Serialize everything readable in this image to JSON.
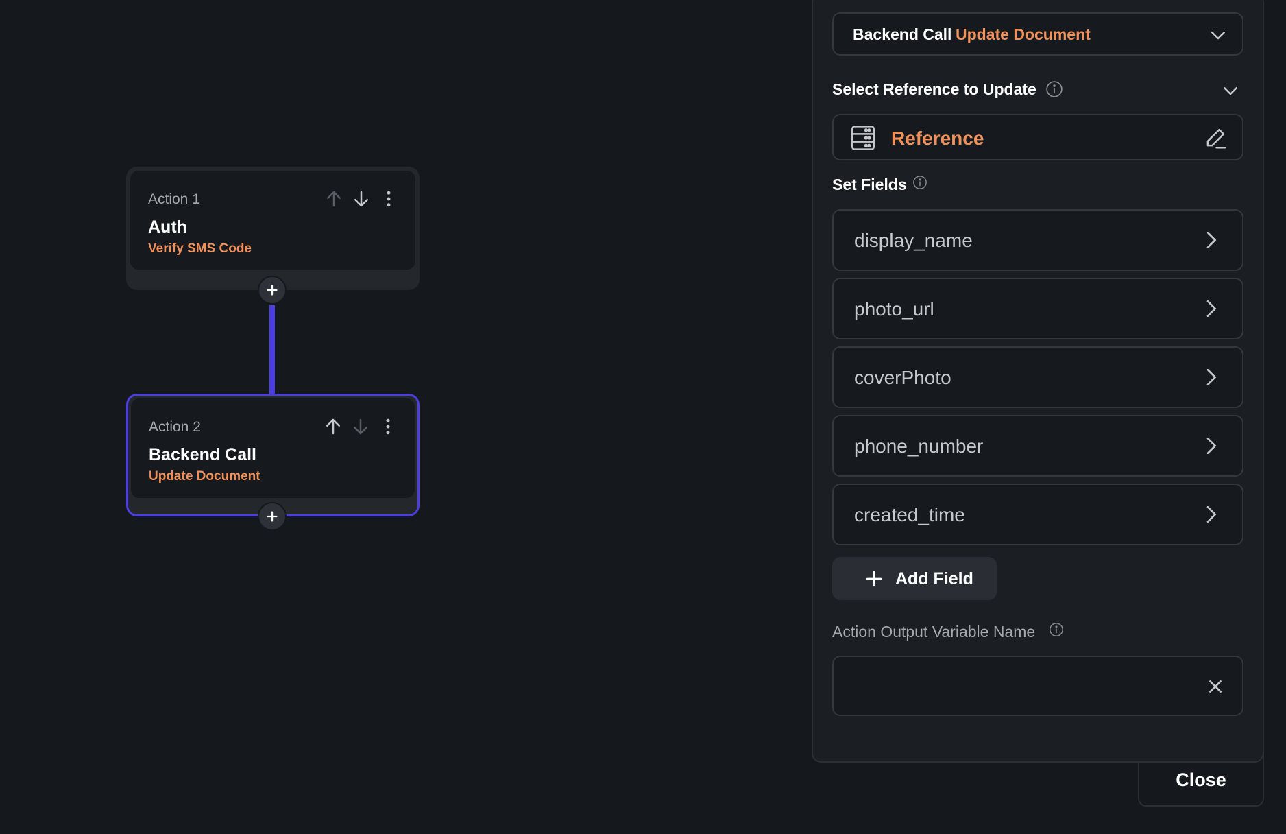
{
  "colors": {
    "accent_orange": "#f0915c",
    "accent_purple": "#4b3fe0",
    "background": "#15181c",
    "panel": "#1b1e22"
  },
  "actions": [
    {
      "label": "Action 1",
      "title": "Auth",
      "subtitle": "Verify SMS Code",
      "selected": false
    },
    {
      "label": "Action 2",
      "title": "Backend Call",
      "subtitle": "Update Document",
      "selected": true
    }
  ],
  "panel": {
    "action_type": {
      "primary": "Backend Call",
      "secondary": "Update Document"
    },
    "select_reference_label": "Select Reference to Update",
    "reference_value": "Reference",
    "set_fields_label": "Set Fields",
    "fields": [
      "display_name",
      "photo_url",
      "coverPhoto",
      "phone_number",
      "created_time"
    ],
    "add_field_label": "Add Field",
    "output_variable_label": "Action Output Variable Name",
    "output_variable_value": "",
    "close_label": "Close"
  },
  "icons": {
    "move_up": "arrow-up-icon",
    "move_down": "arrow-down-icon",
    "more": "more-vertical-icon",
    "add": "plus-icon",
    "dropdown": "chevron-down-icon",
    "info": "info-icon",
    "database": "database-icon",
    "edit": "edit-pencil-icon",
    "navigate": "chevron-right-icon",
    "clear": "close-icon"
  }
}
